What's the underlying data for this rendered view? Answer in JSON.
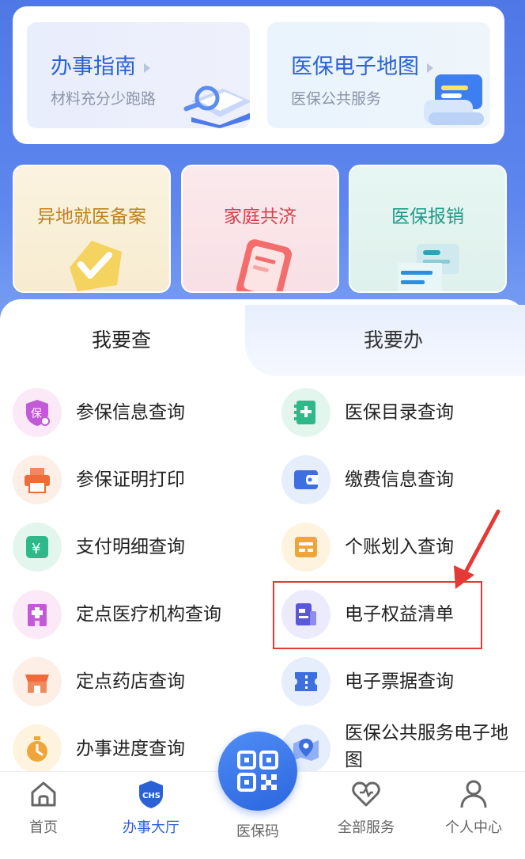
{
  "guides": [
    {
      "title": "办事指南",
      "subtitle": "材料充分少跑路"
    },
    {
      "title": "医保电子地图",
      "subtitle": "医保公共服务"
    }
  ],
  "quick_actions": [
    {
      "label": "异地就医备案"
    },
    {
      "label": "家庭共济"
    },
    {
      "label": "医保报销"
    }
  ],
  "tabs": {
    "active": "我要查",
    "inactive": "我要办"
  },
  "services_left": [
    {
      "label": "参保信息查询",
      "icon": "insurance-shield-icon"
    },
    {
      "label": "参保证明打印",
      "icon": "printer-icon"
    },
    {
      "label": "支付明细查询",
      "icon": "yuan-icon"
    },
    {
      "label": "定点医疗机构查询",
      "icon": "hospital-icon"
    },
    {
      "label": "定点药店查询",
      "icon": "store-icon"
    },
    {
      "label": "办事进度查询",
      "icon": "stopwatch-icon"
    }
  ],
  "services_right": [
    {
      "label": "医保目录查询",
      "icon": "catalog-icon"
    },
    {
      "label": "缴费信息查询",
      "icon": "wallet-icon"
    },
    {
      "label": "个账划入查询",
      "icon": "account-icon"
    },
    {
      "label": "电子权益清单",
      "icon": "document-icon"
    },
    {
      "label": "电子票据查询",
      "icon": "ticket-icon"
    },
    {
      "label_line1": "医保公共服务电子地",
      "label_line2": "图",
      "icon": "map-pin-icon"
    }
  ],
  "nav": {
    "home": "首页",
    "hall": "办事大厅",
    "qr": "医保码",
    "all": "全部服务",
    "me": "个人中心",
    "hall_badge": "CHS"
  },
  "colors": {
    "accent": "#2a62d6",
    "highlight": "#e53935"
  }
}
